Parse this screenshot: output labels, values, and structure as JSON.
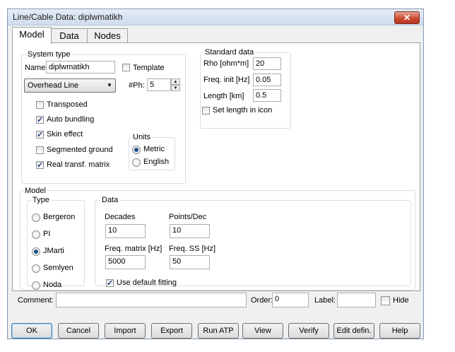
{
  "window": {
    "title": "Line/Cable Data: diplwmatikh",
    "close_glyph": "✕"
  },
  "tabs": [
    "Model",
    "Data",
    "Nodes"
  ],
  "system_type": {
    "legend": "System type",
    "name_label": "Name:",
    "name_value": "diplwmatikh",
    "template_label": "Template",
    "line_type": "Overhead Line",
    "ph_label": "#Ph:",
    "ph_value": "5",
    "options": [
      {
        "label": "Transposed",
        "checked": false
      },
      {
        "label": "Auto bundling",
        "checked": true
      },
      {
        "label": "Skin effect",
        "checked": true
      },
      {
        "label": "Segmented ground",
        "checked": false
      },
      {
        "label": "Real transf. matrix",
        "checked": true
      }
    ],
    "units": {
      "legend": "Units",
      "metric": "Metric",
      "english": "English",
      "selected": "Metric"
    }
  },
  "standard_data": {
    "legend": "Standard data",
    "rho_label": "Rho [ohm*m]",
    "rho_value": "20",
    "freq_label": "Freq. init [Hz]",
    "freq_value": "0.05",
    "length_label": "Length [km]",
    "length_value": "0.5",
    "set_length_label": "Set length in icon"
  },
  "model": {
    "legend": "Model",
    "type_legend": "Type",
    "types": [
      "Bergeron",
      "PI",
      "JMarti",
      "Semlyen",
      "Noda"
    ],
    "selected_type": "JMarti",
    "data_legend": "Data",
    "decades_label": "Decades",
    "decades_value": "10",
    "points_label": "Points/Dec",
    "points_value": "10",
    "freq_matrix_label": "Freq. matrix [Hz]",
    "freq_matrix_value": "5000",
    "freq_ss_label": "Freq. SS [Hz]",
    "freq_ss_value": "50",
    "default_fitting_label": "Use default fitting"
  },
  "footer": {
    "comment_label": "Comment:",
    "comment_value": "",
    "order_label": "Order:",
    "order_value": "0",
    "label_label": "Label:",
    "label_value": "",
    "hide_label": "Hide"
  },
  "buttons": [
    "OK",
    "Cancel",
    "Import",
    "Export",
    "Run ATP",
    "View",
    "Verify",
    "Edit defin.",
    "Help"
  ]
}
